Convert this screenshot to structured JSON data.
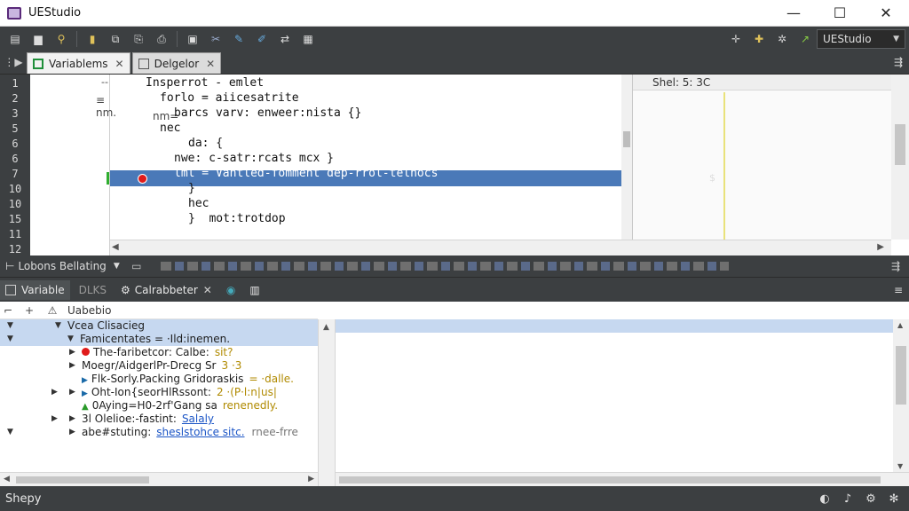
{
  "window": {
    "title": "UEStudio",
    "controls": {
      "minimize": "—",
      "maximize": "☐",
      "close": "✕"
    }
  },
  "toolbar": {
    "icons": [
      "new-file-icon",
      "open-folder-icon",
      "search-icon",
      "bookmark-icon",
      "copy-icon",
      "paste-icon",
      "print-icon",
      "save-icon",
      "cut-icon",
      "edit-icon",
      "brush-icon",
      "find-replace-icon",
      "tools-icon"
    ],
    "config_value": "UEStudio"
  },
  "editor_tabs": {
    "tabs": [
      {
        "label": "Variablems",
        "active": true
      },
      {
        "label": "Delgelor",
        "active": false
      }
    ]
  },
  "editor": {
    "line_numbers": [
      "1",
      "2",
      "3",
      "5",
      "6",
      "6",
      "7",
      "10",
      "10",
      "15",
      "11",
      "12"
    ],
    "fold_markers": [
      "--",
      "≡ nm.",
      "nm=",
      "",
      "",
      "",
      "",
      "",
      "",
      "",
      "",
      ""
    ],
    "lines": [
      {
        "text": "Insperrot - emlet",
        "indent": 2
      },
      {
        "text": "forlo = aiicesatrite",
        "indent": 4
      },
      {
        "text": "barcs varv: enweer:nista {}",
        "indent": 6
      },
      {
        "text": "nec",
        "indent": 4
      },
      {
        "text": "da: {",
        "indent": 8
      },
      {
        "text": "nwe: c-satr:rcats mcx }",
        "indent": 6
      },
      {
        "text": "lml = Vantled-fomment dep-rrol-telnocs",
        "indent": 6
      },
      {
        "text": "}",
        "indent": 8
      },
      {
        "text": "hec",
        "indent": 8
      },
      {
        "text": "}  mot:trotdop",
        "indent": 8
      },
      {
        "text": "",
        "indent": 0
      }
    ],
    "watch_header": "Shel:      5:   3C",
    "watch_marker": "$"
  },
  "debug_bar": {
    "title": "Lobons Bellating"
  },
  "bottom_tabs": {
    "tabs": [
      {
        "label": "Variable",
        "active": true
      },
      {
        "label": "DLKS",
        "active": false
      },
      {
        "label": "Calrabbeter",
        "active": false
      }
    ]
  },
  "variables": {
    "toolbar_label": "Uabebio",
    "rows": [
      {
        "text": "Vcea Clisacieg",
        "level": 1,
        "twisty": "▼",
        "selected": true
      },
      {
        "text": "Famicentates = ·Ild:inemen.",
        "level": 2,
        "twisty": "▼",
        "selected": true
      },
      {
        "text": "The-faribetcor: Calbe:",
        "extra": "sit?",
        "level": 3,
        "twisty": "▶",
        "marker": "red"
      },
      {
        "text": "Moegr/AidgerlPr-Drecg Sr",
        "extra": "3 ·3",
        "level": 3,
        "twisty": "▶"
      },
      {
        "text": "Flk-Sorly.Packing Gridoraskis",
        "extra": "= ·dalle.",
        "level": 3,
        "twisty": "",
        "marker": "blue"
      },
      {
        "text": "Oht-Ion{seorHlRssont:",
        "extra": "2 ·(P·l:n|us|",
        "level": 3,
        "twisty": "▶",
        "marker": "blue"
      },
      {
        "text": "0Aying=H0-2rf'Gang sa",
        "extra": "renenedly.",
        "level": 3,
        "twisty": "",
        "marker": "green"
      },
      {
        "text": "3l Olelioe:-fastint:",
        "extra": "Salaly",
        "level": 3,
        "twisty": "▶"
      },
      {
        "text": "abe#stuting:",
        "extra": "sheslstohce sitc.",
        "extra2": "rnee-frre",
        "level": 3,
        "twisty": "▶"
      }
    ]
  },
  "status": {
    "text": "Shepy"
  }
}
